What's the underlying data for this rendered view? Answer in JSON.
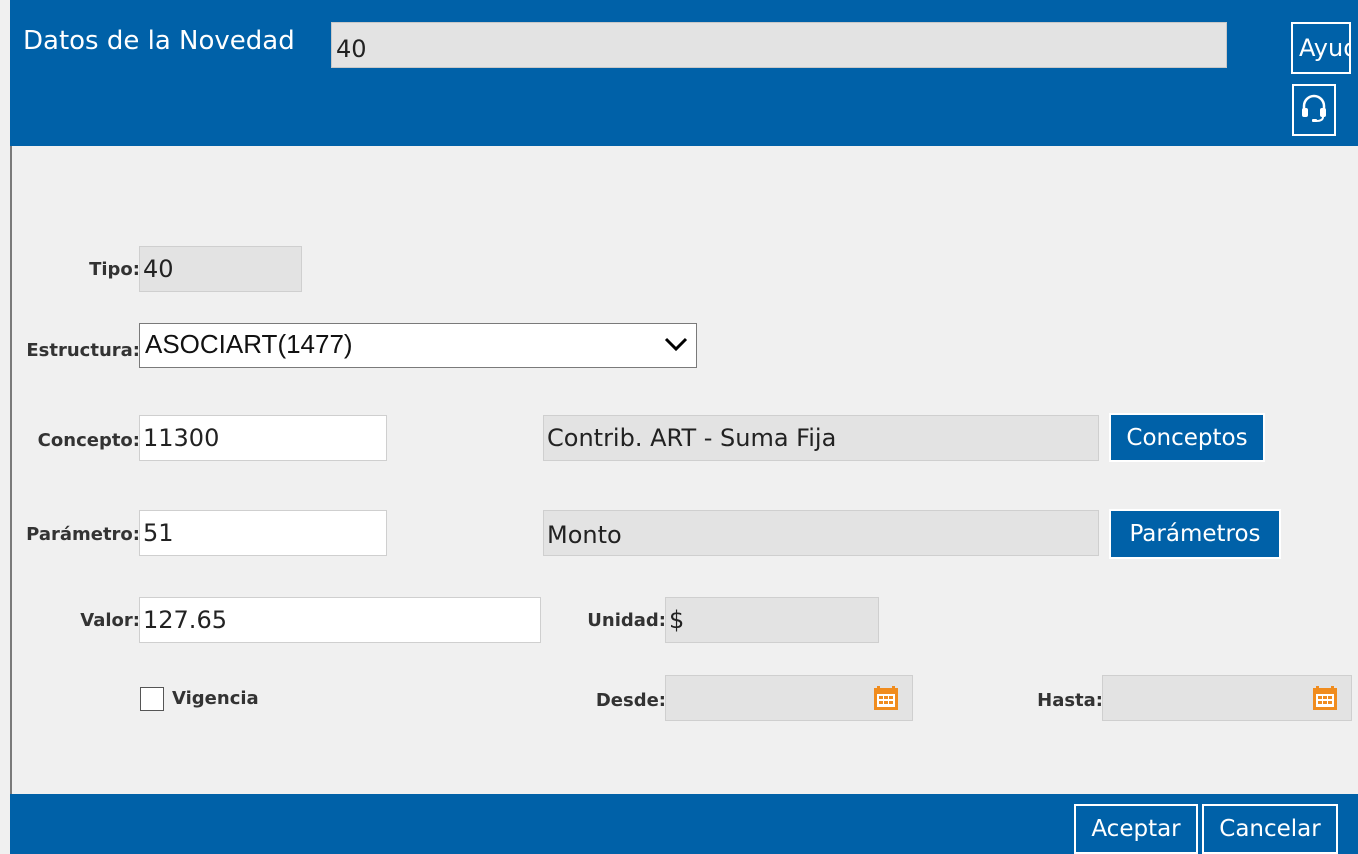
{
  "header": {
    "title": "Datos de la Novedad",
    "novedad_value": "40",
    "help_label": "Ayuda"
  },
  "icons": {
    "support": "headset-icon",
    "structure_dropdown": "chevron-down-icon",
    "calendar": "calendar-icon"
  },
  "colors": {
    "primary": "#0061a8",
    "readonly_bg": "#e3e3e3",
    "calendar_accent": "#f08c1e"
  },
  "form": {
    "tipo": {
      "label": "Tipo:",
      "value": "40"
    },
    "estructura": {
      "label": "Estructura:",
      "value": "ASOCIART(1477)"
    },
    "concepto": {
      "label": "Concepto:",
      "value": "11300",
      "description": "Contrib. ART - Suma Fija",
      "button": "Conceptos"
    },
    "parametro": {
      "label": "Parámetro:",
      "value": "51",
      "description": "Monto",
      "button": "Parámetros"
    },
    "valor": {
      "label": "Valor:",
      "value": "127.65"
    },
    "unidad": {
      "label": "Unidad:",
      "value": "$"
    },
    "vigencia": {
      "label": "Vigencia",
      "checked": false
    },
    "desde": {
      "label": "Desde:",
      "value": ""
    },
    "hasta": {
      "label": "Hasta:",
      "value": ""
    }
  },
  "footer": {
    "accept_label": "Aceptar",
    "cancel_label": "Cancelar"
  }
}
